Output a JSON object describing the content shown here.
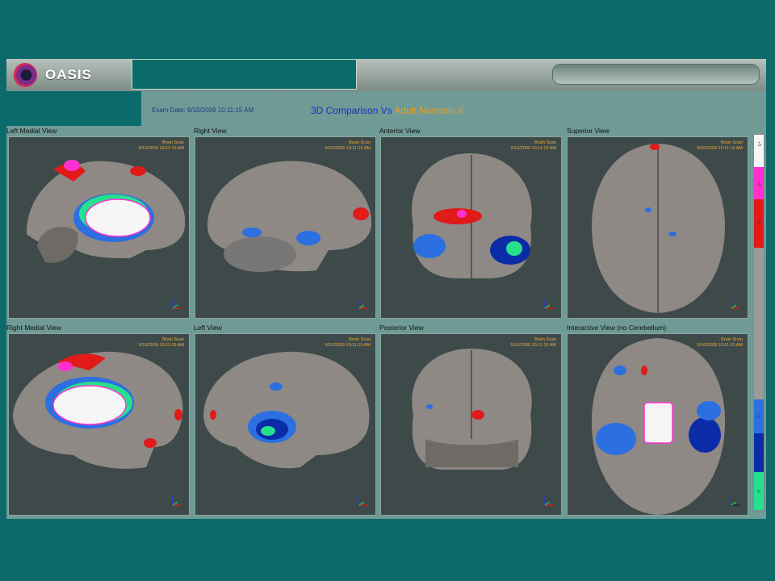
{
  "app": {
    "brand": "OASIS"
  },
  "header": {
    "exam_date": "Exam Date: 9/10/2009 10:11:15 AM",
    "title_main": "3D Comparison Vs ",
    "title_accent": "Adult Normals II"
  },
  "panels": [
    {
      "label": "Left Medial View",
      "tag1": "Brain Scan",
      "tag2": "9/10/2009 10:11:15 AM"
    },
    {
      "label": "Right View",
      "tag1": "Brain Scan",
      "tag2": "9/10/2009 10:11:15 AM"
    },
    {
      "label": "Anterior View",
      "tag1": "Brain Scan",
      "tag2": "9/10/2009 10:11:15 AM"
    },
    {
      "label": "Superior View",
      "tag1": "Brain Scan",
      "tag2": "9/10/2009 10:11:15 AM"
    },
    {
      "label": "Right Medial View",
      "tag1": "Brain Scan",
      "tag2": "9/10/2009 10:11:15 AM"
    },
    {
      "label": "Left View",
      "tag1": "Brain Scan",
      "tag2": "9/10/2009 10:11:15 AM"
    },
    {
      "label": "Posterior View",
      "tag1": "Brain Scan",
      "tag2": "9/10/2009 10:11:15 AM"
    },
    {
      "label": "Interactive View (no Cerebellum)",
      "tag1": "Brain Scan",
      "tag2": "9/10/2009 10:11:15 AM"
    }
  ],
  "colorbar": {
    "labels": [
      "+3",
      "+2",
      "+1",
      "-1",
      "-2",
      "-3"
    ]
  },
  "colors": {
    "background": "#0a6b6a",
    "screen": "#6f9a96",
    "panel": "#3d4a49",
    "brain": "#8f8a86",
    "red": "#e11a1a",
    "magenta": "#ff2fd0",
    "blue": "#2b6fe0",
    "navy": "#0b2ca8",
    "green": "#27e08e",
    "white": "#f6f6f6"
  }
}
